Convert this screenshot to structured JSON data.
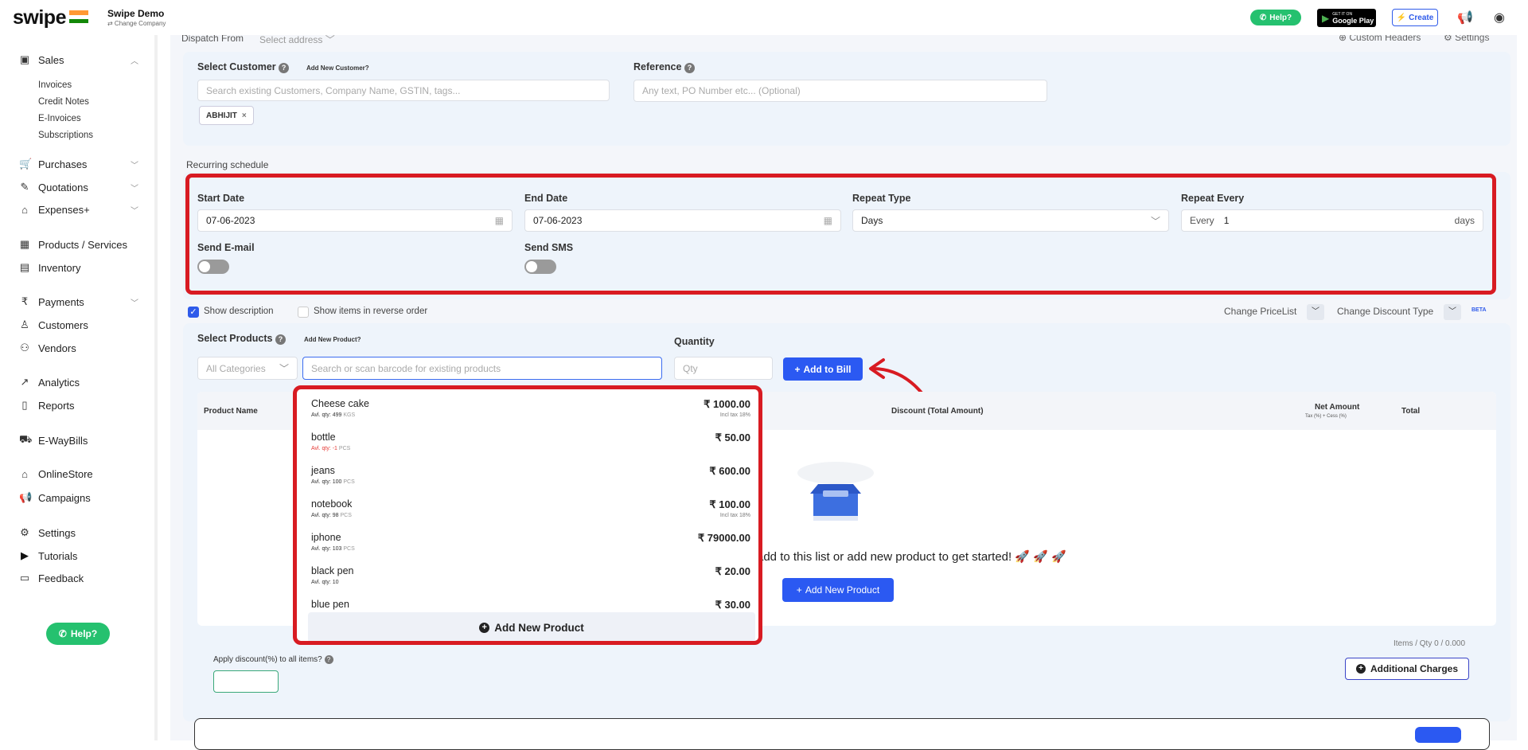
{
  "app": {
    "logo": "swipe",
    "company_name": "Swipe Demo",
    "change_company": "⇄ Change Company"
  },
  "topbar": {
    "help": "Help?",
    "google_play_small": "GET IT ON",
    "google_play": "Google Play",
    "create": "Create"
  },
  "sidebar": {
    "sales": "Sales",
    "sales_sub": [
      "Invoices",
      "Credit Notes",
      "E-Invoices",
      "Subscriptions"
    ],
    "purchases": "Purchases",
    "quotations": "Quotations",
    "expenses": "Expenses+",
    "products": "Products / Services",
    "inventory": "Inventory",
    "payments": "Payments",
    "customers": "Customers",
    "vendors": "Vendors",
    "analytics": "Analytics",
    "reports": "Reports",
    "ewaybills": "E-WayBills",
    "onlinestore": "OnlineStore",
    "campaigns": "Campaigns",
    "settings": "Settings",
    "tutorials": "Tutorials",
    "feedback": "Feedback",
    "help": "Help?"
  },
  "header": {
    "dispatch_from": "Dispatch From",
    "select_address": "Select address",
    "custom_headers": "Custom Headers",
    "settings": "Settings"
  },
  "customer": {
    "label": "Select Customer",
    "add_new": "Add New Customer?",
    "placeholder": "Search existing Customers, Company Name, GSTIN, tags...",
    "tag": "ABHIJIT",
    "reference_label": "Reference",
    "reference_placeholder": "Any text, PO Number etc... (Optional)"
  },
  "recurring": {
    "title": "Recurring schedule",
    "start_label": "Start Date",
    "start_value": "07-06-2023",
    "end_label": "End Date",
    "end_value": "07-06-2023",
    "repeat_type_label": "Repeat Type",
    "repeat_type_value": "Days",
    "repeat_every_label": "Repeat Every",
    "every_prefix": "Every",
    "every_value": "1",
    "every_suffix": "days",
    "send_email": "Send E-mail",
    "send_sms": "Send SMS"
  },
  "options": {
    "show_description": "Show description",
    "reverse_order": "Show items in reverse order",
    "change_pricelist": "Change PriceList",
    "change_discount": "Change Discount Type",
    "beta": "BETA"
  },
  "products": {
    "label": "Select Products",
    "add_new": "Add New Product?",
    "categories": "All Categories",
    "search_placeholder": "Search or scan barcode for existing products",
    "quantity_label": "Quantity",
    "qty_placeholder": "Qty",
    "add_to_bill": "Add to Bill"
  },
  "table": {
    "product_name": "Product Name",
    "discount": "Discount (Total Amount)",
    "net_amount": "Net Amount",
    "net_sub": "Tax (%) + Cess (%)",
    "total": "Total",
    "empty_text": "add to this list or add new product to get started! 🚀 🚀 🚀",
    "add_new_product": "Add New Product",
    "items_qty": "Items / Qty 0 / 0.000",
    "apply_discount": "Apply discount(%) to all items?",
    "additional_charges": "Additional Charges"
  },
  "dropdown": {
    "items": [
      {
        "name": "Cheese cake",
        "stock": "Avl. qty: 499",
        "unit": "KGS",
        "price": "₹ 1000.00",
        "tax": "Incl tax 18%",
        "low": false
      },
      {
        "name": "bottle",
        "stock": "Avl. qty: -1",
        "unit": "PCS",
        "price": "₹ 50.00",
        "tax": "",
        "low": true
      },
      {
        "name": "jeans",
        "stock": "Avl. qty: 100",
        "unit": "PCS",
        "price": "₹ 600.00",
        "tax": "",
        "low": false
      },
      {
        "name": "notebook",
        "stock": "Avl. qty: 98",
        "unit": "PCS",
        "price": "₹ 100.00",
        "tax": "Incl tax 18%",
        "low": false
      },
      {
        "name": "iphone",
        "stock": "Avl. qty: 103",
        "unit": "PCS",
        "price": "₹ 79000.00",
        "tax": "",
        "low": false
      },
      {
        "name": "black pen",
        "stock": "Avl. qty: 10",
        "unit": "",
        "price": "₹ 20.00",
        "tax": "",
        "low": false
      },
      {
        "name": "blue pen",
        "stock": "",
        "unit": "",
        "price": "₹ 30.00",
        "tax": "",
        "low": false
      }
    ],
    "add_new": "Add New Product"
  }
}
